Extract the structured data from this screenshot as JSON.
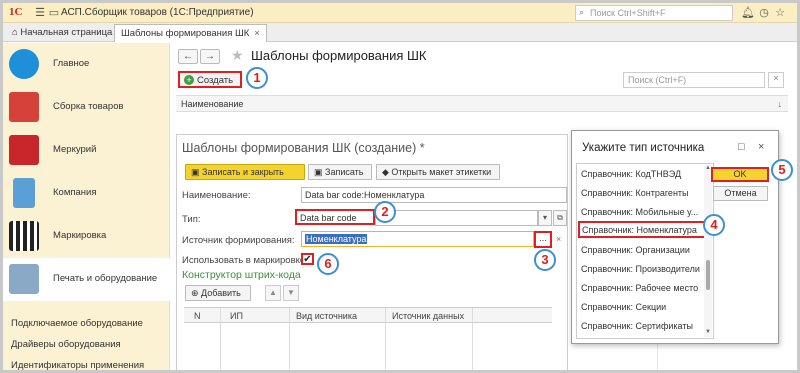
{
  "titlebar": {
    "logo": "1С",
    "title": "АСП.Сборщик товаров  (1С:Предприятие)",
    "search_placeholder": "Поиск Ctrl+Shift+F"
  },
  "tabs": {
    "home": "Начальная страница",
    "active": "Шаблоны формирования ШК"
  },
  "sidebar": {
    "items": [
      {
        "label": "Главное",
        "icon": "globe-icon",
        "color": "#1e8fd8"
      },
      {
        "label": "Сборка товаров",
        "icon": "boxes-icon",
        "color": "#d6423a"
      },
      {
        "label": "Меркурий",
        "icon": "cube-icon",
        "color": "#c8262a"
      },
      {
        "label": "Компания",
        "icon": "building-icon",
        "color": "#5a9fd6"
      },
      {
        "label": "Маркировка",
        "icon": "qr-code-icon",
        "color": "#222222"
      },
      {
        "label": "Печать и оборудование",
        "icon": "printer-icon",
        "color": "#8aa9c6"
      }
    ],
    "subitems": [
      "Подключаемое оборудование",
      "Драйверы оборудования",
      "Идентификаторы применения"
    ]
  },
  "list": {
    "title": "Шаблоны формирования ШК",
    "create_label": "Создать",
    "search_placeholder": "Поиск (Ctrl+F)",
    "column_name": "Наименование"
  },
  "form": {
    "title": "Шаблоны формирования ШК (создание) *",
    "save_close": "Записать и закрыть",
    "save": "Записать",
    "open_layout": "Открыть макет этикетки",
    "name_label": "Наименование:",
    "name_value": "Data bar code:Номенклатура",
    "type_label": "Тип:",
    "type_value": "Data bar code",
    "source_label": "Источник формирования:",
    "source_value": "Номенклатура",
    "use_label": "Использовать в маркировке:",
    "section": "Конструктор штрих-кода",
    "add": "Добавить",
    "columns": [
      "N",
      "ИП",
      "Вид источника",
      "Источник данных"
    ]
  },
  "dialog": {
    "title": "Укажите тип источника",
    "items": [
      "Справочник: КодТНВЭД",
      "Справочник: Контрагенты",
      "Справочник: Мобильные у...",
      "Справочник: Номенклатура",
      "Справочник: Организации",
      "Справочник: Производители",
      "Справочник: Рабочее место",
      "Справочник: Секции",
      "Справочник: Сертификаты"
    ],
    "selected_index": 3,
    "ok": "OK",
    "cancel": "Отмена"
  },
  "callouts": [
    "1",
    "2",
    "3",
    "4",
    "5",
    "6"
  ],
  "colors": {
    "accent_red": "#e02020",
    "callout_blue": "#3b8fd6",
    "yellow": "#f5d32f"
  }
}
